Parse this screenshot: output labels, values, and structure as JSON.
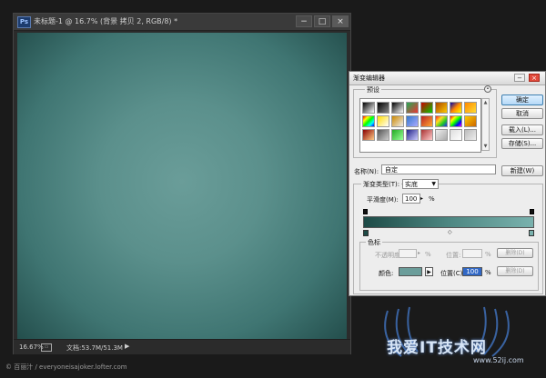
{
  "document": {
    "app_icon": "Ps",
    "title": "未标题-1 @ 16.7% (背景 拷贝 2, RGB/8) *",
    "window_controls": {
      "minimize": "−",
      "maximize": "□",
      "close": "×"
    },
    "status": {
      "zoom": "16.67%",
      "info": "文档:53.7M/51.3M",
      "arrow": "▶"
    }
  },
  "dialog": {
    "title": "渐变编辑器",
    "window_controls": {
      "minimize": "−",
      "close": "×"
    },
    "presets": {
      "label": "预设",
      "menu_icon": "gear-circle-icon"
    },
    "buttons": {
      "ok": "确定",
      "cancel": "取消",
      "load": "载入(L)...",
      "save": "存储(S)...",
      "new": "新建(W)"
    },
    "name": {
      "label": "名称(N):",
      "value": "自定"
    },
    "gradient_type": {
      "label": "渐变类型(T):",
      "value": "实底"
    },
    "smoothness": {
      "label": "平滑度(M):",
      "value": "100",
      "unit": "%"
    },
    "stops": {
      "label": "色标",
      "opacity_label": "不透明度:",
      "opacity_unit": "%",
      "opacity_location_label": "位置:",
      "opacity_location_unit": "%",
      "delete_label_1": "删除(D)",
      "color_label": "颜色:",
      "location_label": "位置(C):",
      "location_value": "100",
      "location_unit": "%",
      "delete_label_2": "删除(D)"
    },
    "colors": {
      "gradient_start": "#1d4a46",
      "gradient_end": "#7ab2ae",
      "stop_color": "#6b9d9a"
    }
  },
  "footer": {
    "caption": "© 百丽汁 / everyoneisajoker.lofter.com",
    "watermark_text": "我爱IT技术网",
    "watermark_url": "www.52ij.com"
  }
}
